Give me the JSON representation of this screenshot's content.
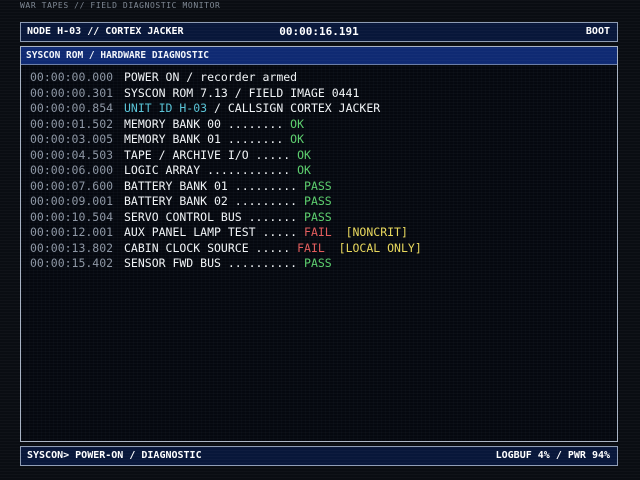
{
  "window": {
    "caption": "WAR TAPES // FIELD DIAGNOSTIC MONITOR"
  },
  "header": {
    "node": "NODE H-03 // CORTEX JACKER",
    "clock": "00:00:16.191",
    "mode": "BOOT"
  },
  "panel": {
    "title": "SYSCON ROM / HARDWARE DIAGNOSTIC"
  },
  "log": [
    {
      "time": "00:00:00.000",
      "text": "POWER ON / recorder armed",
      "status": "",
      "note": ""
    },
    {
      "time": "00:00:00.301",
      "text": "SYSCON ROM 7.13 / FIELD IMAGE 0441",
      "status": "",
      "note": ""
    },
    {
      "time": "00:00:00.854",
      "unit": "UNIT ID H-03",
      "text": " / CALLSIGN CORTEX JACKER",
      "status": "",
      "note": ""
    },
    {
      "time": "00:00:01.502",
      "text": "MEMORY BANK 00 ........ ",
      "status": "OK",
      "note": ""
    },
    {
      "time": "00:00:03.005",
      "text": "MEMORY BANK 01 ........ ",
      "status": "OK",
      "note": ""
    },
    {
      "time": "00:00:04.503",
      "text": "TAPE / ARCHIVE I/O ..... ",
      "status": "OK",
      "note": ""
    },
    {
      "time": "00:00:06.000",
      "text": "LOGIC ARRAY ............ ",
      "status": "OK",
      "note": ""
    },
    {
      "time": "00:00:07.600",
      "text": "BATTERY BANK 01 ......... ",
      "status": "PASS",
      "note": ""
    },
    {
      "time": "00:00:09.001",
      "text": "BATTERY BANK 02 ......... ",
      "status": "PASS",
      "note": ""
    },
    {
      "time": "00:00:10.504",
      "text": "SERVO CONTROL BUS ....... ",
      "status": "PASS",
      "note": ""
    },
    {
      "time": "00:00:12.001",
      "text": "AUX PANEL LAMP TEST ..... ",
      "status": "FAIL",
      "note": "[NONCRIT]"
    },
    {
      "time": "00:00:13.802",
      "text": "CABIN CLOCK SOURCE ..... ",
      "status": "FAIL",
      "note": "[LOCAL ONLY]"
    },
    {
      "time": "00:00:15.402",
      "text": "SENSOR FWD BUS .......... ",
      "status": "PASS",
      "note": ""
    }
  ],
  "footer": {
    "prompt": "SYSCON> POWER-ON / DIAGNOSTIC",
    "stats": "LOGBUF 4% / PWR 94%"
  },
  "colors": {
    "ok": "#5ccf6e",
    "fail": "#e35c5c",
    "note": "#e8d75c",
    "unit": "#58c3d6",
    "header_bg": "#0f2a73"
  }
}
